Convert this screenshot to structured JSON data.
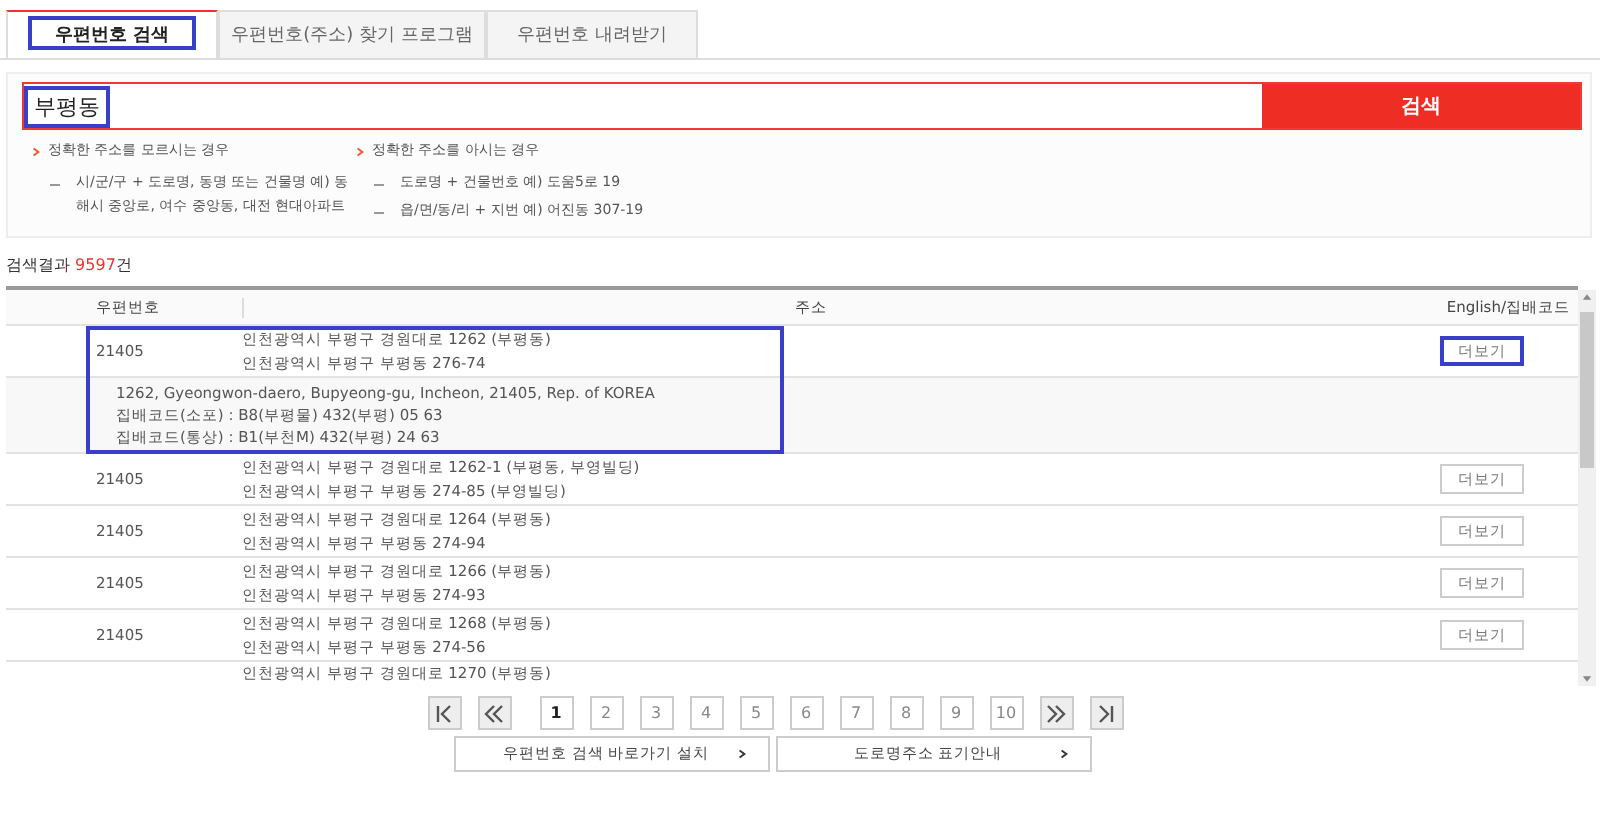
{
  "tabs": [
    {
      "label": "우편번호 검색",
      "selected": true,
      "highlighted": true
    },
    {
      "label": "우편번호(주소) 찾기 프로그램",
      "selected": false,
      "highlighted": false
    },
    {
      "label": "우편번호 내려받기",
      "selected": false,
      "highlighted": false
    }
  ],
  "search": {
    "value": "부평동",
    "highlighted": true,
    "button": "검색"
  },
  "hints": [
    {
      "title": "정확한 주소를 모르시는 경우",
      "items": [
        "시/군/구 + 도로명, 동명 또는 건물명 예) 동해시 중앙로, 여수 중앙동, 대전 현대아파트"
      ]
    },
    {
      "title": "정확한 주소를 아시는 경우",
      "items": [
        "도로명 + 건물번호 예) 도움5로 19",
        "읍/면/동/리 + 지번 예) 어진동 307-19"
      ]
    }
  ],
  "result": {
    "label": "검색결과",
    "count": "9597",
    "unit": "건"
  },
  "table": {
    "columns": [
      "우편번호",
      "주소",
      "English/집배코드"
    ],
    "rows": [
      {
        "zip": "21405",
        "address": [
          "인천광역시 부평구 경원대로 1262 (부평동)",
          "인천광역시 부평구 부평동 276-74"
        ],
        "button": "더보기",
        "highlighted": true,
        "detail": [
          "1262, Gyeongwon-daero, Bupyeong-gu, Incheon, 21405, Rep. of KOREA",
          "집배코드(소포) : B8(부평물) 432(부평) 05 63",
          "집배코드(통상) : B1(부천M) 432(부평) 24 63"
        ]
      },
      {
        "zip": "21405",
        "address": [
          "인천광역시 부평구 경원대로 1262-1 (부평동, 부영빌딩)",
          "인천광역시 부평구 부평동 274-85 (부영빌딩)"
        ],
        "button": "더보기",
        "highlighted": false
      },
      {
        "zip": "21405",
        "address": [
          "인천광역시 부평구 경원대로 1264 (부평동)",
          "인천광역시 부평구 부평동 274-94"
        ],
        "button": "더보기",
        "highlighted": false
      },
      {
        "zip": "21405",
        "address": [
          "인천광역시 부평구 경원대로 1266 (부평동)",
          "인천광역시 부평구 부평동 274-93"
        ],
        "button": "더보기",
        "highlighted": false
      },
      {
        "zip": "21405",
        "address": [
          "인천광역시 부평구 경원대로 1268 (부평동)",
          "인천광역시 부평구 부평동 274-56"
        ],
        "button": "더보기",
        "highlighted": false
      },
      {
        "address": [
          "인천광역시 부평구 경원대로 1270 (부평동)"
        ],
        "highlighted": false
      }
    ]
  },
  "pagination": [
    {
      "label": "1",
      "selected": true
    },
    {
      "label": "2",
      "selected": false
    },
    {
      "label": "3",
      "selected": false
    },
    {
      "label": "4",
      "selected": false
    },
    {
      "label": "5",
      "selected": false
    },
    {
      "label": "6",
      "selected": false
    },
    {
      "label": "7",
      "selected": false
    },
    {
      "label": "8",
      "selected": false
    },
    {
      "label": "9",
      "selected": false
    },
    {
      "label": "10",
      "selected": false
    }
  ],
  "links": [
    "우편번호 검색 바로가기 설치",
    "도로명주소 표기안내"
  ]
}
